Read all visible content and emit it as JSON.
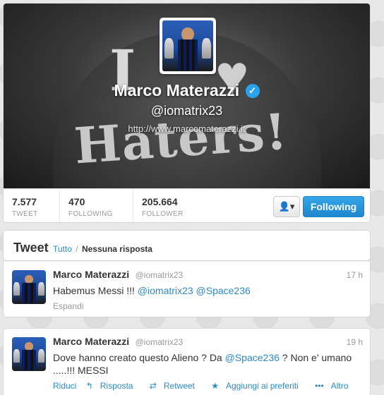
{
  "profile": {
    "name": "Marco Materazzi",
    "handle": "@iomatrix23",
    "website": "http://www.marcomaterazzi.it",
    "banner_text_i": "I",
    "banner_text_haters": "Haters!"
  },
  "stats": [
    {
      "value": "7.577",
      "label": "TWEET"
    },
    {
      "value": "470",
      "label": "FOLLOWING"
    },
    {
      "value": "205.664",
      "label": "FOLLOWER"
    }
  ],
  "actions": {
    "user_menu_icon": "person-dropdown-icon",
    "follow_label": "Following"
  },
  "tweets_header": {
    "title": "Tweet",
    "filter_all": "Tutto",
    "separator": "/",
    "filter_no_replies": "Nessuna risposta"
  },
  "tweets": [
    {
      "name": "Marco Materazzi",
      "handle": "@iomatrix23",
      "time": "17 h",
      "text_plain": "Habemus Messi !!! ",
      "mention1": "@iomatrix23",
      "mention2": "@Space236",
      "expand": "Espandi"
    },
    {
      "name": "Marco Materazzi",
      "handle": "@iomatrix23",
      "time": "19 h",
      "text_before": "Dove hanno creato questo Alieno ? Da ",
      "mention": "@Space236",
      "text_after": " ? Non e' umano .....!!! MESSI",
      "collapse": "Riduci",
      "reply": "Risposta",
      "retweet": "Retweet",
      "favorite": "Aggiungi ai preferiti",
      "more": "Altro"
    }
  ],
  "colors": {
    "accent": "#2a8ac9",
    "follow_button": "#2aa3ef",
    "verified": "#2aa3ef"
  }
}
